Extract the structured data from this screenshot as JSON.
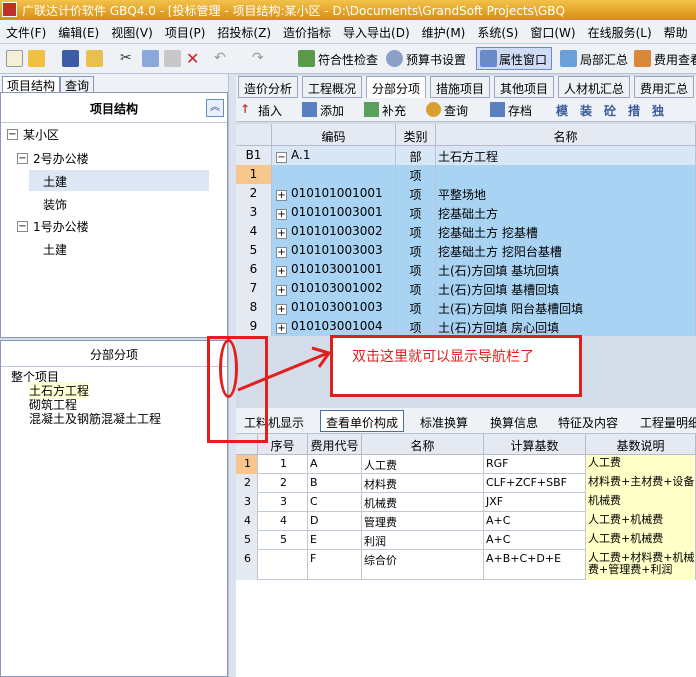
{
  "window": {
    "title": "广联达计价软件 GBQ4.0 - [投标管理 - 项目结构:某小区 - D:\\Documents\\GrandSoft Projects\\GBQ"
  },
  "menu": [
    "文件(F)",
    "编辑(E)",
    "视图(V)",
    "项目(P)",
    "招投标(Z)",
    "造价指标",
    "导入导出(D)",
    "维护(M)",
    "系统(S)",
    "窗口(W)",
    "在线服务(L)",
    "帮助"
  ],
  "toolbar": {
    "compliance_check": "符合性检查",
    "budget_settings": "预算书设置",
    "property_window": "属性窗口",
    "local_summary": "局部汇总",
    "fee_view": "费用查看"
  },
  "left_tabs": [
    "项目结构",
    "查询"
  ],
  "project_panel": {
    "title": "项目结构",
    "root": "某小区",
    "building2": "2号办公楼",
    "b2_items": [
      "土建",
      "装饰"
    ],
    "building1": "1号办公楼",
    "b1_items": [
      "土建"
    ]
  },
  "fbfx_panel": {
    "title": "分部分项",
    "items": [
      "整个项目",
      "土石方工程",
      "砌筑工程",
      "混凝土及钢筋混凝土工程"
    ]
  },
  "right_tabs": [
    "造价分析",
    "工程概况",
    "分部分项",
    "措施项目",
    "其他项目",
    "人材机汇总",
    "费用汇总"
  ],
  "right_toolbar": {
    "insert": "插入",
    "add": "添加",
    "supplement": "补充",
    "query": "查询",
    "save": "存档",
    "glyphs": [
      "模",
      "装",
      "砼",
      "措",
      "独"
    ]
  },
  "grid": {
    "headers": [
      "编码",
      "类别",
      "名称"
    ],
    "rows": [
      {
        "num": "B1",
        "code": "A.1",
        "type": "部",
        "name": "土石方工程"
      },
      {
        "num": "1",
        "code": "",
        "type": "项",
        "name": ""
      },
      {
        "num": "2",
        "code": "010101001001",
        "type": "项",
        "name": "平整场地"
      },
      {
        "num": "3",
        "code": "010101003001",
        "type": "项",
        "name": "挖基础土方"
      },
      {
        "num": "4",
        "code": "010101003002",
        "type": "项",
        "name": "挖基础土方 挖基槽"
      },
      {
        "num": "5",
        "code": "010101003003",
        "type": "项",
        "name": "挖基础土方 挖阳台基槽"
      },
      {
        "num": "6",
        "code": "010103001001",
        "type": "项",
        "name": "土(石)方回填 基坑回填"
      },
      {
        "num": "7",
        "code": "010103001002",
        "type": "项",
        "name": "土(石)方回填 基槽回填"
      },
      {
        "num": "8",
        "code": "010103001003",
        "type": "项",
        "name": "土(石)方回填 阳台基槽回填"
      },
      {
        "num": "9",
        "code": "010103001004",
        "type": "项",
        "name": "土(石)方回填 房心回填"
      }
    ]
  },
  "annotation": {
    "text": "双击这里就可以显示导航栏了"
  },
  "bottom_tabs": [
    "工料机显示",
    "查看单价构成",
    "标准换算",
    "换算信息",
    "特征及内容",
    "工程量明细"
  ],
  "bottom_grid": {
    "headers": [
      "序号",
      "费用代号",
      "名称",
      "计算基数",
      "基数说明"
    ],
    "rows": [
      {
        "num": "1",
        "seq": "1",
        "code": "A",
        "name": "人工费",
        "base": "RGF",
        "desc": "人工费"
      },
      {
        "num": "2",
        "seq": "2",
        "code": "B",
        "name": "材料费",
        "base": "CLF+ZCF+SBF",
        "desc": "材料费+主材费+设备"
      },
      {
        "num": "3",
        "seq": "3",
        "code": "C",
        "name": "机械费",
        "base": "JXF",
        "desc": "机械费"
      },
      {
        "num": "4",
        "seq": "4",
        "code": "D",
        "name": "管理费",
        "base": "A+C",
        "desc": "人工费+机械费"
      },
      {
        "num": "5",
        "seq": "5",
        "code": "E",
        "name": "利润",
        "base": "A+C",
        "desc": "人工费+机械费"
      },
      {
        "num": "6",
        "seq": "",
        "code": "F",
        "name": "综合价",
        "base": "A+B+C+D+E",
        "desc": "人工费+材料费+机械费+管理费+利润"
      }
    ]
  },
  "colors": {
    "title_bar": "#e0a020",
    "selected_row": "#a9d3f2",
    "annotation": "#e0201c",
    "highlight": "#ffffc8"
  }
}
